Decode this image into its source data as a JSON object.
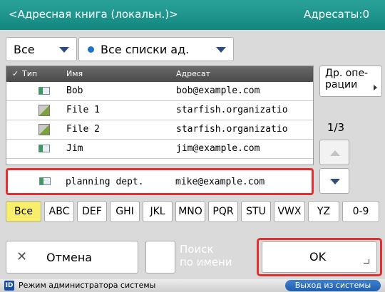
{
  "title": "<Адресная книга (локальн.)>",
  "address_count": "Адресаты:0",
  "dropdowns": {
    "all": "Все",
    "lists": "Все списки ад."
  },
  "list": {
    "header": {
      "type": "Тип",
      "name": "Имя",
      "address": "Адресат"
    },
    "rows": [
      {
        "name": "Bob",
        "address": "bob@example.com",
        "icon": "contact-card-icon"
      },
      {
        "name": "File 1",
        "address": "starfish.organizatio",
        "icon": "file-server-icon"
      },
      {
        "name": "File 2",
        "address": "starfish.organizatio",
        "icon": "file-server-icon"
      },
      {
        "name": "Jim",
        "address": "jim@example.com",
        "icon": "contact-card-icon"
      }
    ],
    "highlighted": {
      "name": "planning dept.",
      "address": "mike@example.com",
      "icon": "contact-card-icon"
    }
  },
  "more_ops": "Др. опе-\nрации",
  "page": "1/3",
  "filters": [
    "Все",
    "ABC",
    "DEF",
    "GHI",
    "JKL",
    "MNO",
    "PQR",
    "STU",
    "VWX",
    "YZ",
    "0-9"
  ],
  "actions": {
    "cancel": "Отмена",
    "search_name": "Поиск\nпо имени",
    "ok": "OK"
  },
  "status": {
    "admin_mode": "Режим администратора системы",
    "id_badge": "ID",
    "logout": "Выход из системы"
  },
  "colors": {
    "titlebar": "#1a8f87",
    "active_filter": "#f7ef6c",
    "highlight": "#e03030",
    "logout": "#2a6cc0"
  }
}
